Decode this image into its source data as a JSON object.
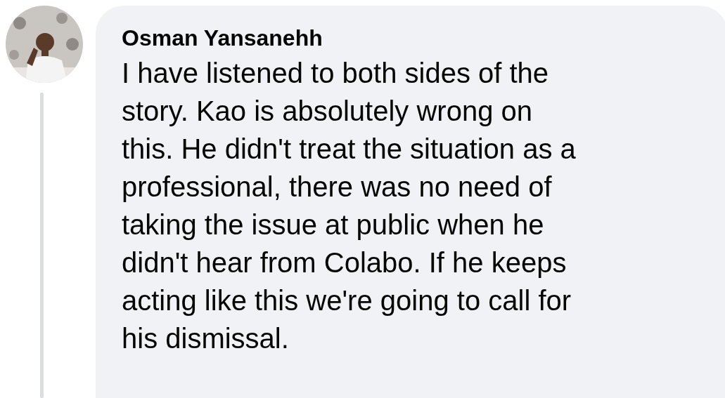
{
  "comment": {
    "author": "Osman Yansanehh",
    "lines": [
      "I have listened to both sides of the",
      "story. Kao is absolutely wrong on",
      "this. He didn't treat the situation as a",
      "professional, there was no need of",
      "taking the issue at public when he",
      "didn't hear from Colabo. If he keeps",
      "acting like this we're going to call for",
      "his dismissal."
    ]
  }
}
